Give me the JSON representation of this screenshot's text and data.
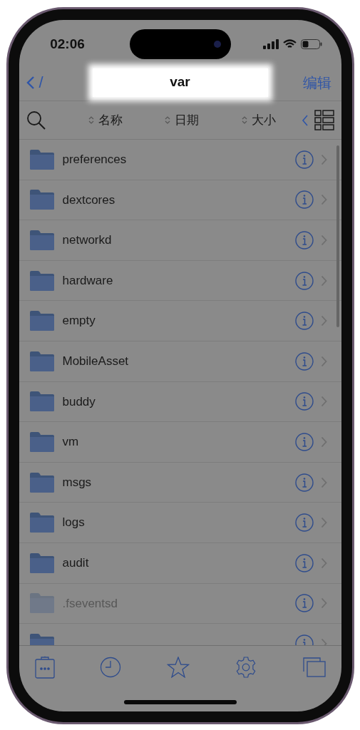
{
  "status_bar": {
    "time": "02:06"
  },
  "nav": {
    "back_label": "/",
    "title": "var",
    "edit": "编辑"
  },
  "sort_columns": [
    {
      "label": "名称"
    },
    {
      "label": "日期"
    },
    {
      "label": "大小"
    }
  ],
  "files": [
    {
      "kind": "folder",
      "name": "preferences",
      "hidden": false
    },
    {
      "kind": "folder",
      "name": "dextcores",
      "hidden": false
    },
    {
      "kind": "folder",
      "name": "networkd",
      "hidden": false
    },
    {
      "kind": "folder",
      "name": "hardware",
      "hidden": false
    },
    {
      "kind": "folder",
      "name": "empty",
      "hidden": false
    },
    {
      "kind": "folder",
      "name": "MobileAsset",
      "hidden": false
    },
    {
      "kind": "folder",
      "name": "buddy",
      "hidden": false
    },
    {
      "kind": "folder",
      "name": "vm",
      "hidden": false
    },
    {
      "kind": "folder",
      "name": "msgs",
      "hidden": false
    },
    {
      "kind": "folder",
      "name": "logs",
      "hidden": false
    },
    {
      "kind": "folder",
      "name": "audit",
      "hidden": false
    },
    {
      "kind": "folder",
      "name": ".fseventsd",
      "hidden": true
    },
    {
      "kind": "partial"
    }
  ]
}
